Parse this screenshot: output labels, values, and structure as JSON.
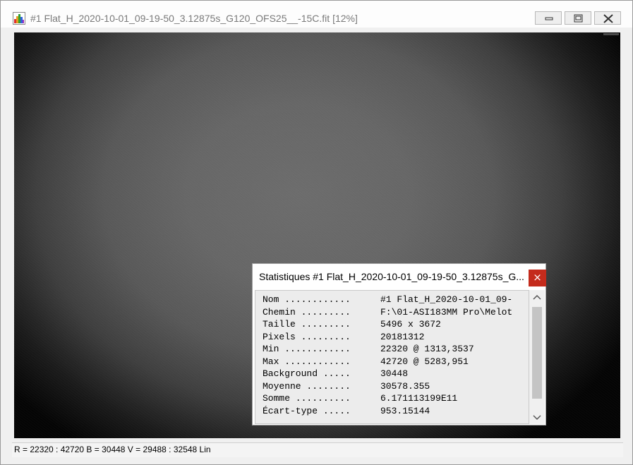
{
  "window": {
    "title": "#1 Flat_H_2020-10-01_09-19-50_3.12875s_G120_OFS25__-15C.fit  [12%]",
    "icons": {
      "app": "histogram-icon",
      "minimize": "minimize-icon",
      "maximize": "maximize-icon",
      "close": "close-icon"
    }
  },
  "statusbar": {
    "text": "R = 22320 : 42720   B = 30448   V = 29488 : 32548 Lin"
  },
  "stats": {
    "title": "Statistiques #1 Flat_H_2020-10-01_09-19-50_3.12875s_G...",
    "close_label": "×",
    "rows": [
      {
        "key": "Nom  ............",
        "value": "#1 Flat_H_2020-10-01_09-"
      },
      {
        "key": "Chemin  .........",
        "value": "F:\\01-ASI183MM Pro\\Melot"
      },
      {
        "key": "Taille  .........",
        "value": "5496 x 3672"
      },
      {
        "key": "Pixels  .........",
        "value": "20181312"
      },
      {
        "key": "Min  ............",
        "value": "22320 @ 1313,3537"
      },
      {
        "key": "Max  ............",
        "value": "42720 @ 5283,951"
      },
      {
        "key": "Background  .....",
        "value": "30448"
      },
      {
        "key": "Moyenne  ........",
        "value": "30578.355"
      },
      {
        "key": "Somme  ..........",
        "value": "6.171113199E11"
      },
      {
        "key": "Écart-type  .....",
        "value": "953.15144"
      }
    ]
  },
  "colors": {
    "close_red": "#c42b1c"
  }
}
